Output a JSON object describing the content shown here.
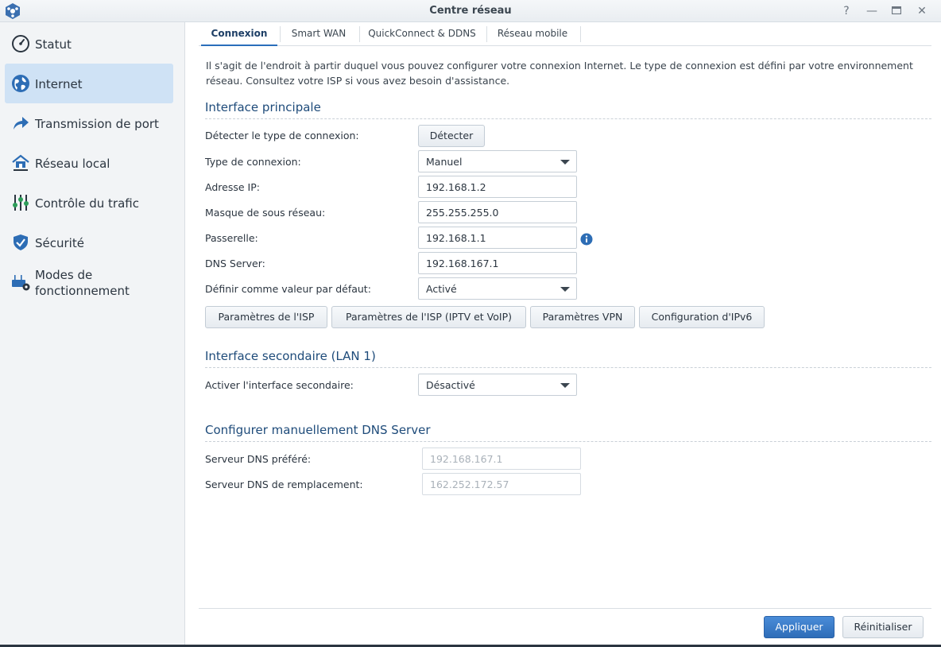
{
  "window": {
    "title": "Centre réseau",
    "help_icon": "help-icon",
    "minimize_icon": "minimize-icon",
    "maximize_icon": "maximize-icon",
    "close_icon": "close-icon"
  },
  "sidebar": {
    "items": [
      {
        "label": "Statut",
        "icon": "gauge-icon"
      },
      {
        "label": "Internet",
        "icon": "globe-icon",
        "active": true
      },
      {
        "label": "Transmission de port",
        "icon": "share-arrow-icon"
      },
      {
        "label": "Réseau local",
        "icon": "home-network-icon"
      },
      {
        "label": "Contrôle du trafic",
        "icon": "sliders-icon"
      },
      {
        "label": "Sécurité",
        "icon": "shield-icon"
      },
      {
        "label": "Modes de",
        "label2": "fonctionnement",
        "icon": "router-gear-icon"
      }
    ]
  },
  "tabs": [
    {
      "label": "Connexion",
      "active": true
    },
    {
      "label": "Smart WAN"
    },
    {
      "label": "QuickConnect & DDNS"
    },
    {
      "label": "Réseau mobile"
    }
  ],
  "main": {
    "description": "Il s'agit de l'endroit à partir duquel vous pouvez configurer votre connexion Internet. Le type de connexion est défini par votre environnement réseau. Consultez votre ISP si vous avez besoin d'assistance.",
    "primary": {
      "title": "Interface principale",
      "detect_label": "Détecter le type de connexion:",
      "detect_button": "Détecter",
      "conn_type_label": "Type de connexion:",
      "conn_type_value": "Manuel",
      "ip_label": "Adresse IP:",
      "ip_value": "192.168.1.2",
      "mask_label": "Masque de sous réseau:",
      "mask_value": "255.255.255.0",
      "gateway_label": "Passerelle:",
      "gateway_value": "192.168.1.1",
      "dns_label": "DNS Server:",
      "dns_value": "192.168.167.1",
      "default_label": "Définir comme valeur par défaut:",
      "default_value": "Activé",
      "buttons": {
        "isp": "Paramètres de l'ISP",
        "isp_iptv": "Paramètres de l'ISP (IPTV et VoIP)",
        "vpn": "Paramètres VPN",
        "ipv6": "Configuration d'IPv6"
      }
    },
    "secondary": {
      "title": "Interface secondaire (LAN 1)",
      "enable_label": "Activer l'interface secondaire:",
      "enable_value": "Désactivé"
    },
    "manual_dns": {
      "title": "Configurer manuellement DNS Server",
      "preferred_label": "Serveur DNS préféré:",
      "preferred_value": "192.168.167.1",
      "alternate_label": "Serveur DNS de remplacement:",
      "alternate_value": "162.252.172.57"
    }
  },
  "footer": {
    "apply": "Appliquer",
    "reset": "Réinitialiser"
  },
  "colors": {
    "accent": "#2e6db8",
    "sidebar_active": "#cfe2f5",
    "section_title": "#1e4b7a"
  }
}
